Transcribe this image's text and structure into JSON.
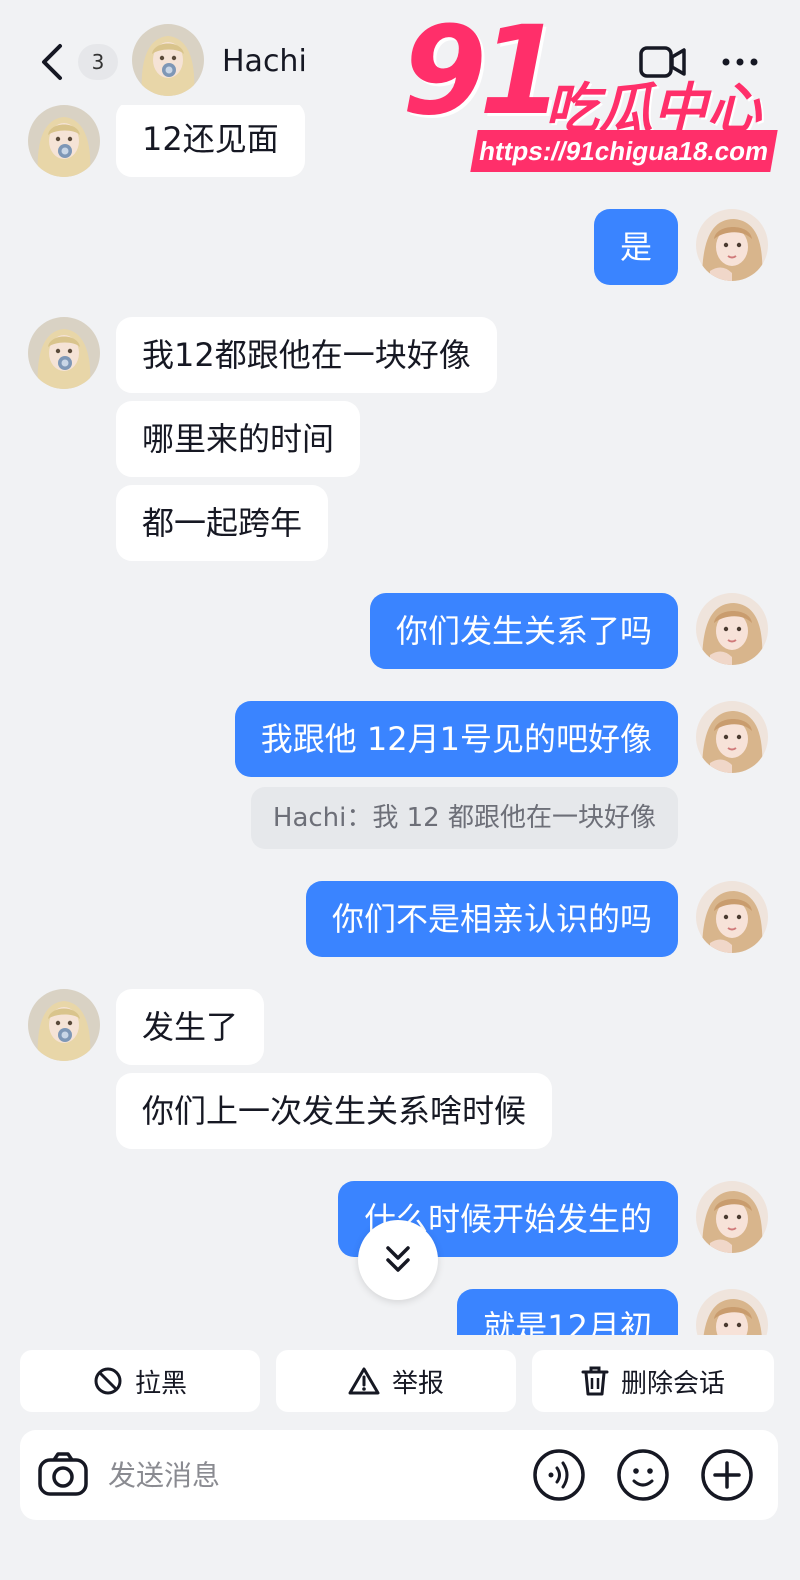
{
  "header": {
    "unread_count": "3",
    "contact_name": "Hachi",
    "icons": [
      "chevron-left-icon",
      "video-call-icon",
      "more-icon"
    ]
  },
  "watermark": {
    "number": "91",
    "text": "吃瓜中心",
    "url": "https://91chigua18.com"
  },
  "messages": [
    {
      "side": "in",
      "text": "12还见面"
    },
    {
      "side": "out",
      "text": "是"
    },
    {
      "side": "in",
      "text": "我12都跟他在一块好像"
    },
    {
      "side": "in",
      "text": "哪里来的时间"
    },
    {
      "side": "in",
      "text": "都一起跨年"
    },
    {
      "side": "out",
      "text": "你们发生关系了吗"
    },
    {
      "side": "out",
      "text": "我跟他 12月1号见的吧好像"
    },
    {
      "side": "quote",
      "text": "Hachi：我 12 都跟他在一块好像"
    },
    {
      "side": "out",
      "text": "你们不是相亲认识的吗"
    },
    {
      "side": "in",
      "text": "发生了"
    },
    {
      "side": "in",
      "text": "你们上一次发生关系啥时候"
    },
    {
      "side": "out",
      "text": "什么时候开始发生的"
    },
    {
      "side": "out",
      "text": "就是12月初"
    }
  ],
  "actions": {
    "block_label": "拉黑",
    "report_label": "举报",
    "delete_label": "删除会话"
  },
  "composer": {
    "placeholder": "发送消息"
  },
  "colors": {
    "background": "#f1f2f4",
    "outgoing_bubble": "#3a84ff",
    "incoming_bubble": "#ffffff",
    "watermark": "#ff2f6a"
  }
}
